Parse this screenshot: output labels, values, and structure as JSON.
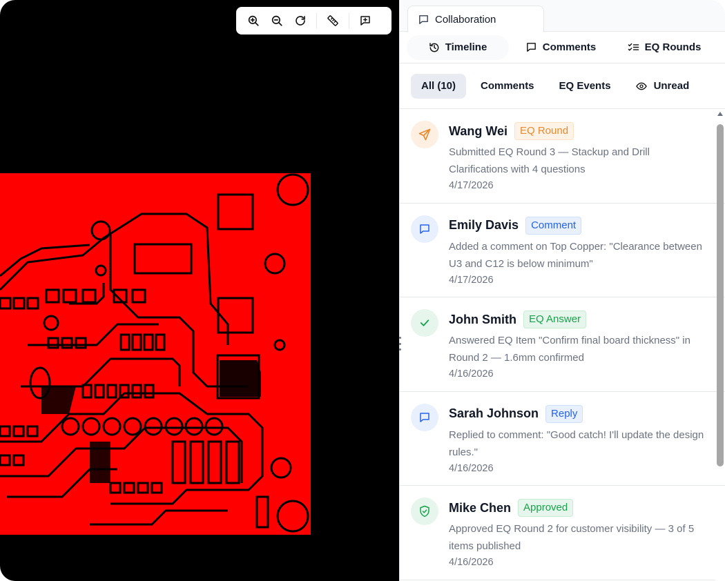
{
  "viewer": {
    "toolbar": {
      "zoom_in_icon": "zoom-in-icon",
      "zoom_out_icon": "zoom-out-icon",
      "reset_icon": "rotate-icon",
      "measure_icon": "ruler-icon",
      "comment_icon": "add-comment-icon"
    },
    "board_color": "#ff0000",
    "background_color": "#000000"
  },
  "panel": {
    "tab_label": "Collaboration",
    "subtabs": [
      {
        "label": "Timeline",
        "icon": "history-icon",
        "active": true
      },
      {
        "label": "Comments",
        "icon": "comment-icon",
        "active": false
      },
      {
        "label": "EQ Rounds",
        "icon": "checklist-icon",
        "active": false
      }
    ],
    "filters": [
      {
        "label": "All (10)",
        "active": true
      },
      {
        "label": "Comments",
        "active": false
      },
      {
        "label": "EQ Events",
        "active": false
      },
      {
        "label": "Unread",
        "icon": "eye-icon",
        "active": false
      }
    ],
    "items": [
      {
        "name": "Wang Wei",
        "badge": "EQ Round",
        "badge_color": "#ea8a2e",
        "icon": "send-icon",
        "text": "Submitted EQ Round 3 — Stackup and Drill Clarifications with 4 questions",
        "date": "4/17/2026"
      },
      {
        "name": "Emily Davis",
        "badge": "Comment",
        "badge_color": "#2563eb",
        "icon": "comment-icon",
        "text": "Added a comment on Top Copper: \"Clearance between U3 and C12 is below minimum\"",
        "date": "4/17/2026"
      },
      {
        "name": "John Smith",
        "badge": "EQ Answer",
        "badge_color": "#16a34a",
        "icon": "check-icon",
        "text": "Answered EQ Item \"Confirm final board thickness\" in Round 2 — 1.6mm confirmed",
        "date": "4/16/2026"
      },
      {
        "name": "Sarah Johnson",
        "badge": "Reply",
        "badge_color": "#2563eb",
        "icon": "comment-icon",
        "text": "Replied to comment: \"Good catch! I'll update the design rules.\"",
        "date": "4/16/2026"
      },
      {
        "name": "Mike Chen",
        "badge": "Approved",
        "badge_color": "#16a34a",
        "icon": "shield-check-icon",
        "text": "Approved EQ Round 2 for customer visibility — 3 of 5 items published",
        "date": "4/16/2026"
      }
    ]
  }
}
